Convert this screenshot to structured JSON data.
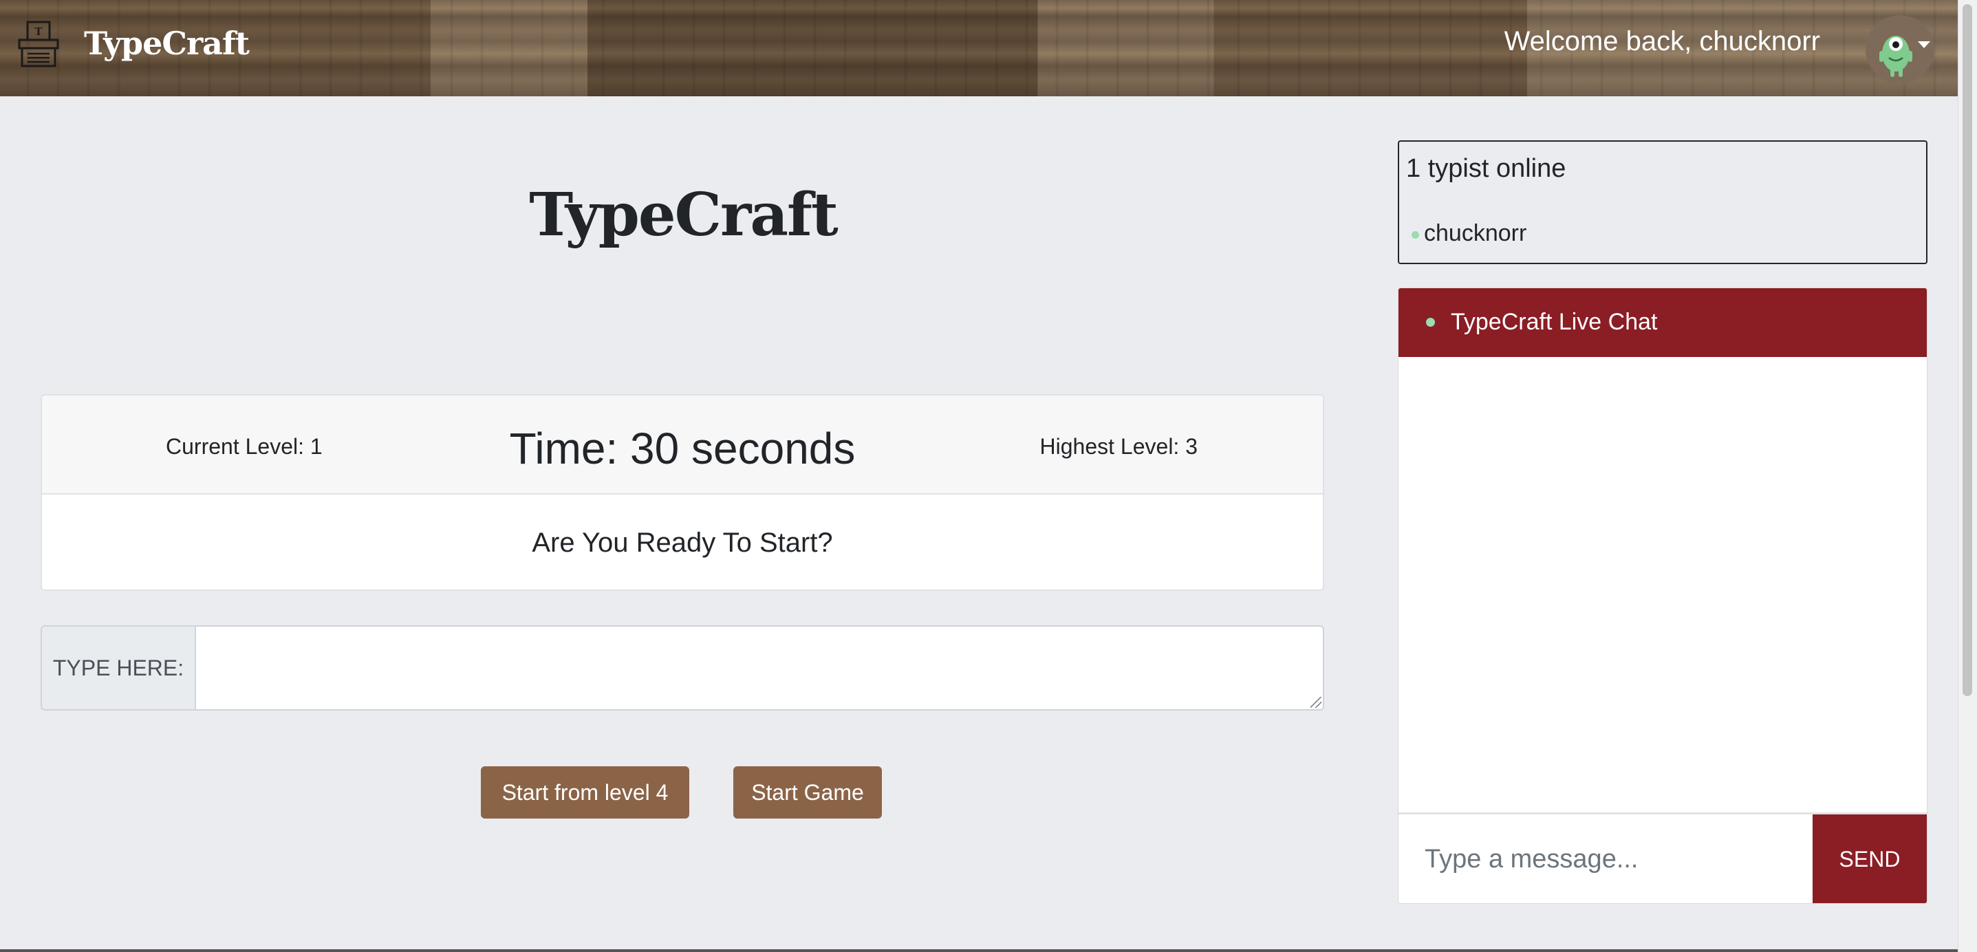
{
  "navbar": {
    "brand": "TypeCraft",
    "welcome": "Welcome back, chucknorr",
    "logo_icon": "typewriter-icon",
    "avatar_icon": "green-monster-avatar",
    "caret_icon": "caret-down-icon"
  },
  "main": {
    "title": "TypeCraft"
  },
  "game": {
    "current_level": "Current Level: 1",
    "time": "Time: 30 seconds",
    "highest_level": "Highest Level: 3",
    "ready_text": "Are You Ready To Start?",
    "type_label": "TYPE HERE:",
    "type_value": "",
    "start_from_level_label": "Start from level 4",
    "start_game_label": "Start Game"
  },
  "online": {
    "count_text": "1 typist online",
    "users": [
      "chucknorr"
    ],
    "status_color": "#9ddbb0"
  },
  "chat": {
    "title": "TypeCraft Live Chat",
    "input_placeholder": "Type a message...",
    "input_value": "",
    "send_label": "SEND",
    "accent_color": "#8b1d25"
  },
  "colors": {
    "button_brown": "#8b6448",
    "page_background": "#ebecf0"
  }
}
